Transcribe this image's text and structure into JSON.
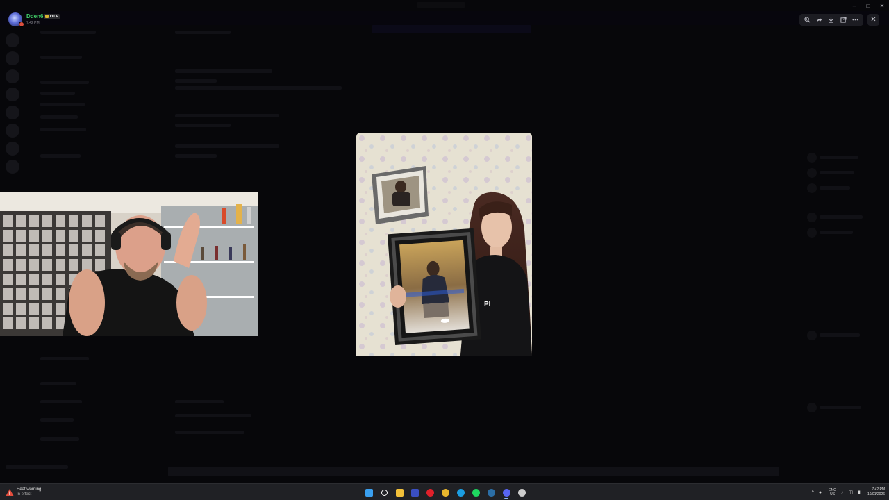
{
  "viewer": {
    "user_name": "Dden6",
    "guild_tag": "TYCE",
    "post_time": "7:42 PM"
  },
  "toolbar": {
    "buttons": [
      {
        "name": "zoom",
        "icon": "zoom-icon"
      },
      {
        "name": "forward",
        "icon": "forward-icon"
      },
      {
        "name": "download",
        "icon": "download-icon"
      },
      {
        "name": "open-in-browser",
        "icon": "external-link-icon"
      },
      {
        "name": "more",
        "icon": "more-icon"
      }
    ],
    "close_icon": "close-icon"
  },
  "taskbar": {
    "weather_title": "Heat warning",
    "weather_subtitle": "In effect",
    "apps": [
      {
        "name": "start",
        "color": "#3aa0f0"
      },
      {
        "name": "search",
        "color": "#ffffff"
      },
      {
        "name": "file-explorer",
        "color": "#f3c13a"
      },
      {
        "name": "app-blue-square",
        "color": "#3a4fc2"
      },
      {
        "name": "opera",
        "color": "#e0202a"
      },
      {
        "name": "chrome",
        "color": "#e9b72d"
      },
      {
        "name": "edge",
        "color": "#1b9de2"
      },
      {
        "name": "spotify",
        "color": "#1ed760"
      },
      {
        "name": "steam",
        "color": "#2b6ea6"
      },
      {
        "name": "discord",
        "color": "#5865f2"
      },
      {
        "name": "app-misc",
        "color": "#cccccc"
      }
    ],
    "active_app": "discord",
    "lang_top": "ENG",
    "lang_bottom": "US",
    "time": "7:42 PM",
    "date": "10/01/2026"
  }
}
